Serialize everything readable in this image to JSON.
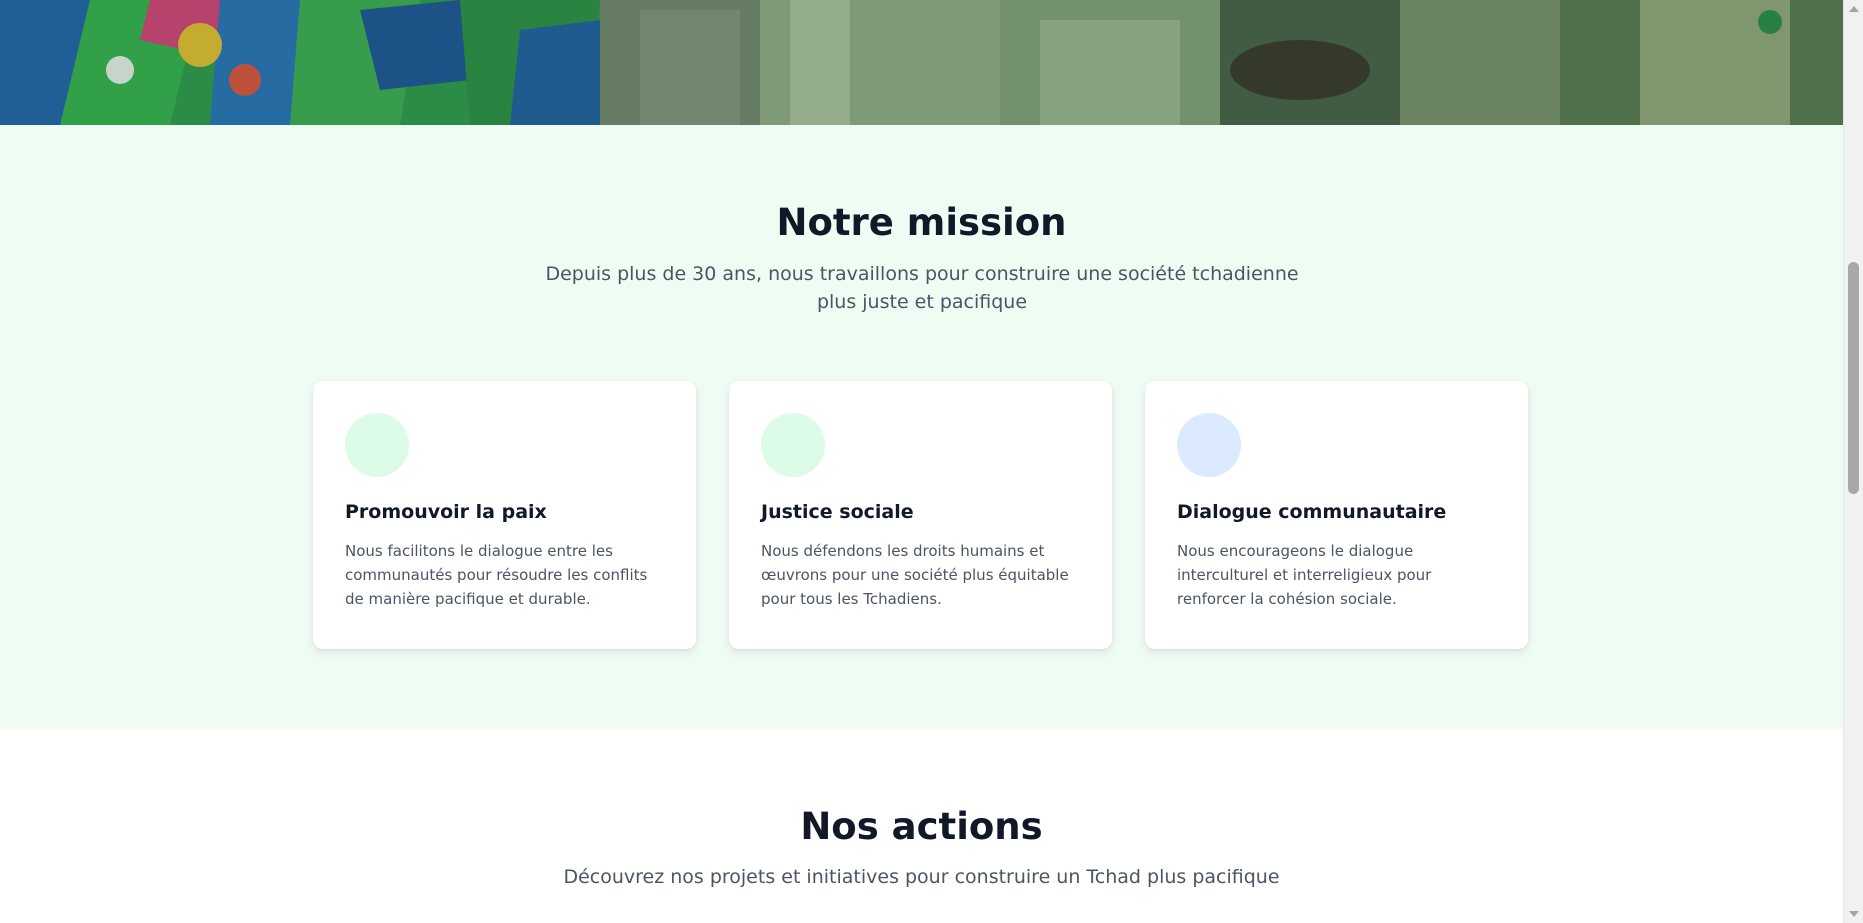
{
  "mission": {
    "title": "Notre mission",
    "subtitle": "Depuis plus de 30 ans, nous travaillons pour construire une société tchadienne plus juste et pacifique",
    "cards": [
      {
        "title": "Promouvoir la paix",
        "text": "Nous facilitons le dialogue entre les communautés pour résoudre les conflits de manière pacifique et durable.",
        "icon": "peace-icon",
        "icon_color": "#dcfce7"
      },
      {
        "title": "Justice sociale",
        "text": "Nous défendons les droits humains et œuvrons pour une société plus équitable pour tous les Tchadiens.",
        "icon": "justice-icon",
        "icon_color": "#dcfce7"
      },
      {
        "title": "Dialogue communautaire",
        "text": "Nous encourageons le dialogue interculturel et interreligieux pour renforcer la cohésion sociale.",
        "icon": "dialogue-icon",
        "icon_color": "#dbeafe"
      }
    ]
  },
  "actions": {
    "title": "Nos actions",
    "subtitle": "Découvrez nos projets et initiatives pour construire un Tchad plus pacifique"
  },
  "colors": {
    "section_bg": "#effcf3",
    "heading": "#111827",
    "body_text": "#4b5563"
  }
}
